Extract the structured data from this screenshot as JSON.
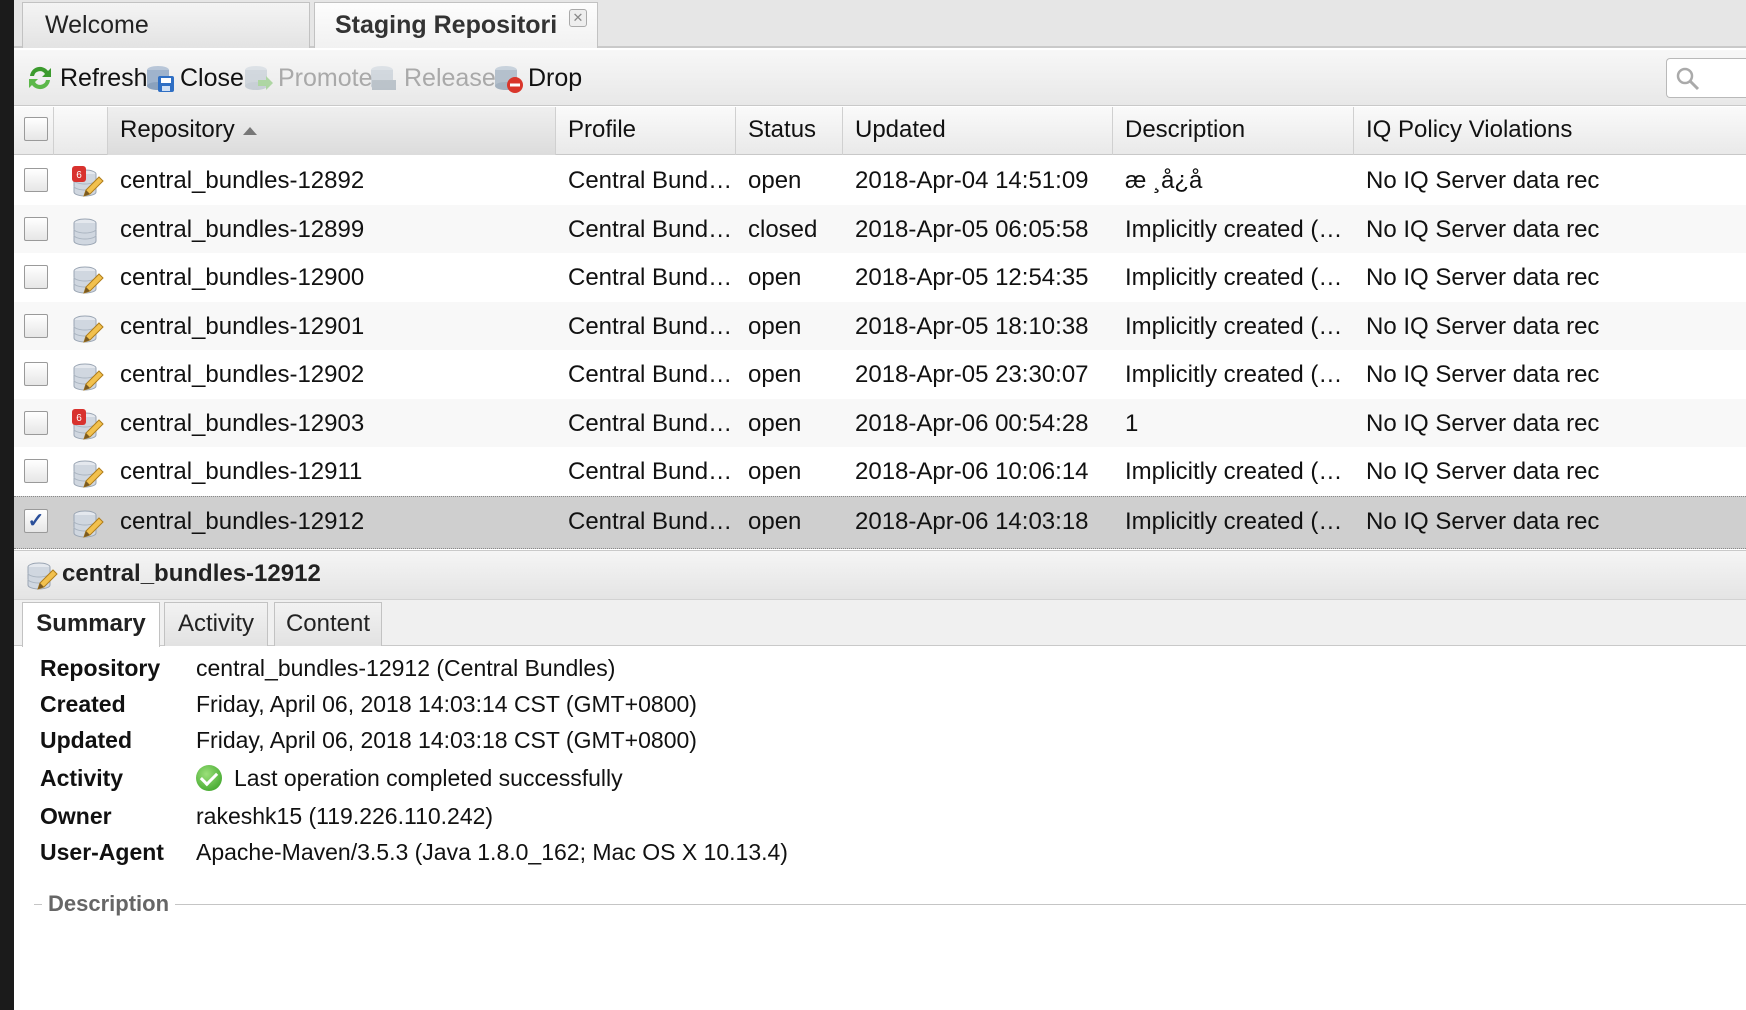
{
  "tabs": {
    "welcome": "Welcome",
    "staging": "Staging Repositori"
  },
  "toolbar": {
    "refresh": "Refresh",
    "close": "Close",
    "promote": "Promote",
    "release": "Release",
    "drop": "Drop"
  },
  "grid": {
    "columns": [
      "Repository",
      "Profile",
      "Status",
      "Updated",
      "Description",
      "IQ Policy Violations"
    ],
    "sorted_column": "Repository",
    "sort_direction": "ascending",
    "rows": [
      {
        "repository": "central_bundles-12892",
        "profile": "Central Bundles",
        "status": "open",
        "updated": "2018-Apr-04 14:51:09",
        "description": "æ ¸å¿å",
        "iq": "No IQ Server data rec",
        "icon": "repo-open-with-badge-icon",
        "badge": "6",
        "checked": ""
      },
      {
        "repository": "central_bundles-12899",
        "profile": "Central Bundles",
        "status": "closed",
        "updated": "2018-Apr-05 06:05:58",
        "description": "Implicitly created (auto staging).",
        "iq": "No IQ Server data rec",
        "icon": "repo-closed-icon",
        "badge": "",
        "checked": ""
      },
      {
        "repository": "central_bundles-12900",
        "profile": "Central Bundles",
        "status": "open",
        "updated": "2018-Apr-05 12:54:35",
        "description": "Implicitly created (auto staging).",
        "iq": "No IQ Server data rec",
        "icon": "repo-open-icon",
        "badge": "",
        "checked": ""
      },
      {
        "repository": "central_bundles-12901",
        "profile": "Central Bundles",
        "status": "open",
        "updated": "2018-Apr-05 18:10:38",
        "description": "Implicitly created (auto staging).",
        "iq": "No IQ Server data rec",
        "icon": "repo-open-icon",
        "badge": "",
        "checked": ""
      },
      {
        "repository": "central_bundles-12902",
        "profile": "Central Bundles",
        "status": "open",
        "updated": "2018-Apr-05 23:30:07",
        "description": "Implicitly created (auto staging).",
        "iq": "No IQ Server data rec",
        "icon": "repo-open-icon",
        "badge": "",
        "checked": ""
      },
      {
        "repository": "central_bundles-12903",
        "profile": "Central Bundles",
        "status": "open",
        "updated": "2018-Apr-06 00:54:28",
        "description": "1",
        "iq": "No IQ Server data rec",
        "icon": "repo-open-with-badge-icon",
        "badge": "6",
        "checked": ""
      },
      {
        "repository": "central_bundles-12911",
        "profile": "Central Bundles",
        "status": "open",
        "updated": "2018-Apr-06 10:06:14",
        "description": "Implicitly created (auto staging).",
        "iq": "No IQ Server data rec",
        "icon": "repo-open-icon",
        "badge": "",
        "checked": ""
      },
      {
        "repository": "central_bundles-12912",
        "profile": "Central Bundles",
        "status": "open",
        "updated": "2018-Apr-06 14:03:18",
        "description": "Implicitly created (auto staging).",
        "iq": "No IQ Server data rec",
        "icon": "repo-open-icon",
        "badge": "",
        "checked": "✓"
      }
    ]
  },
  "detail": {
    "title": "central_bundles-12912",
    "tabs": [
      "Summary",
      "Activity",
      "Content"
    ],
    "active_tab": "Summary",
    "properties": [
      {
        "key": "Repository",
        "value": "central_bundles-12912 (Central Bundles)"
      },
      {
        "key": "Created",
        "value": "Friday, April 06, 2018 14:03:14 CST (GMT+0800)"
      },
      {
        "key": "Updated",
        "value": "Friday, April 06, 2018 14:03:18 CST (GMT+0800)"
      },
      {
        "key": "Activity",
        "value": "Last operation completed successfully"
      },
      {
        "key": "Owner",
        "value": "rakeshk15 (119.226.110.242)"
      },
      {
        "key": "User-Agent",
        "value": "Apache-Maven/3.5.3 (Java 1.8.0_162; Mac OS X 10.13.4)"
      }
    ],
    "description_section": "Description"
  },
  "colors": {
    "selected_row": "#cfcfcf",
    "success": "#2f9b1d",
    "disabled_text": "#a9a9a9"
  }
}
